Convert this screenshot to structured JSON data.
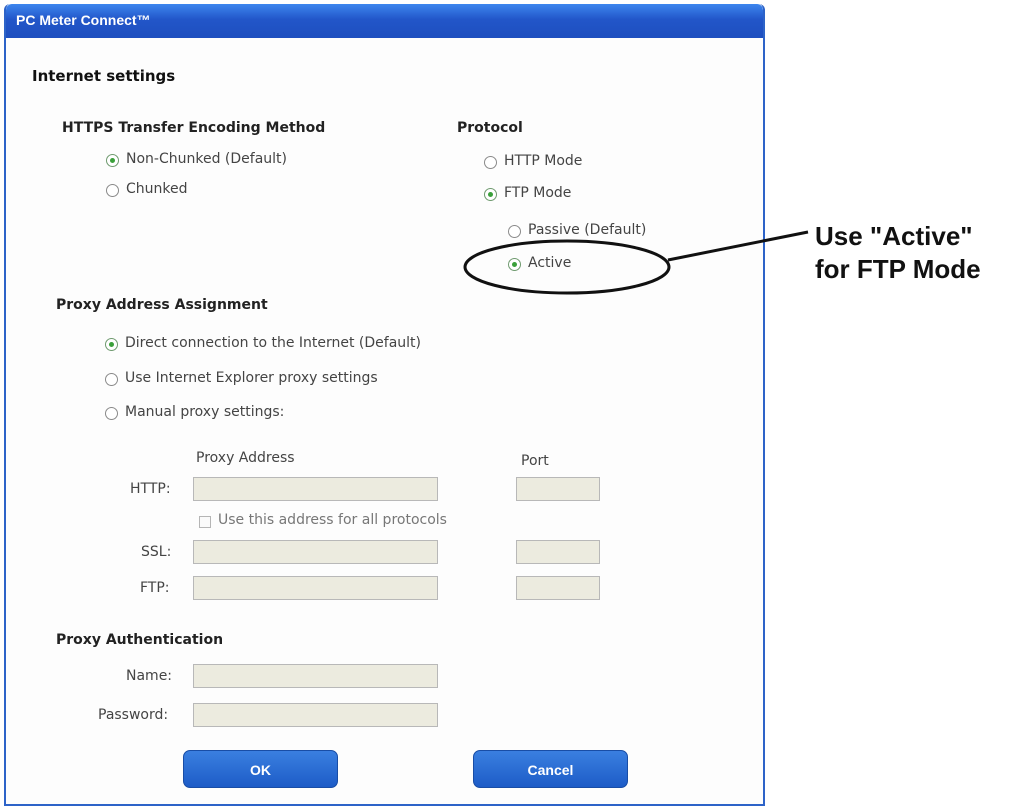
{
  "window": {
    "title": "PC Meter Connect™"
  },
  "section_title": "Internet settings",
  "https_encoding": {
    "heading": "HTTPS Transfer Encoding Method",
    "options": [
      {
        "label": "Non-Chunked  (Default)",
        "checked": true
      },
      {
        "label": "Chunked",
        "checked": false
      }
    ]
  },
  "protocol": {
    "heading": "Protocol",
    "options": [
      {
        "label": "HTTP Mode",
        "checked": false
      },
      {
        "label": "FTP Mode",
        "checked": true
      }
    ],
    "ftp_options": [
      {
        "label": "Passive (Default)",
        "checked": false
      },
      {
        "label": "Active",
        "checked": true
      }
    ]
  },
  "proxy_assignment": {
    "heading": "Proxy Address Assignment",
    "options": [
      {
        "label": "Direct connection to the Internet  (Default)",
        "checked": true
      },
      {
        "label": "Use Internet Explorer proxy settings",
        "checked": false
      },
      {
        "label": "Manual proxy settings:",
        "checked": false
      }
    ]
  },
  "proxy_table": {
    "address_header": "Proxy Address",
    "port_header": "Port",
    "http_label": "HTTP:",
    "ssl_label": "SSL:",
    "ftp_label": "FTP:",
    "same_address_label": "Use this address for all protocols",
    "same_address_checked": false,
    "http_address": "",
    "http_port": "",
    "ssl_address": "",
    "ssl_port": "",
    "ftp_address": "",
    "ftp_port": ""
  },
  "proxy_auth": {
    "heading": "Proxy Authentication",
    "name_label": "Name:",
    "password_label": "Password:",
    "name_value": "",
    "password_value": ""
  },
  "buttons": {
    "ok": "OK",
    "cancel": "Cancel"
  },
  "callout": {
    "line1": "Use \"Active\"",
    "line2": "for FTP Mode"
  },
  "colors": {
    "titlebar": "#2256c9",
    "button": "#1d5cc7",
    "radio_selected": "#3aa03a",
    "field_bg": "#ecebdf"
  }
}
